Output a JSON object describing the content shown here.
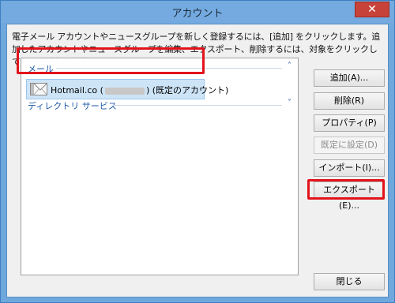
{
  "window": {
    "title": "アカウント"
  },
  "description": "電子メール アカウントやニュースグループを新しく登録するには、[追加] をクリックします。追加したアカウントやニュースグループを編集、エクスポート、削除するには、対象をクリックしてから、希望の動作をクリックします。",
  "groups": [
    {
      "label": "メール",
      "chevron": "˄"
    },
    {
      "label": "ディレクトリ サービス",
      "chevron": "˅"
    }
  ],
  "account": {
    "name": "Hotmail.co (",
    "suffix": ") (既定のアカウント)"
  },
  "buttons": {
    "add": "追加(A)...",
    "delete": "削除(R)",
    "properties": "プロパティ(P)",
    "set_default": "既定に設定(D)",
    "import": "インポート(I)...",
    "export": "エクスポート(E)...",
    "close": "閉じる"
  },
  "close_glyph": "✕"
}
